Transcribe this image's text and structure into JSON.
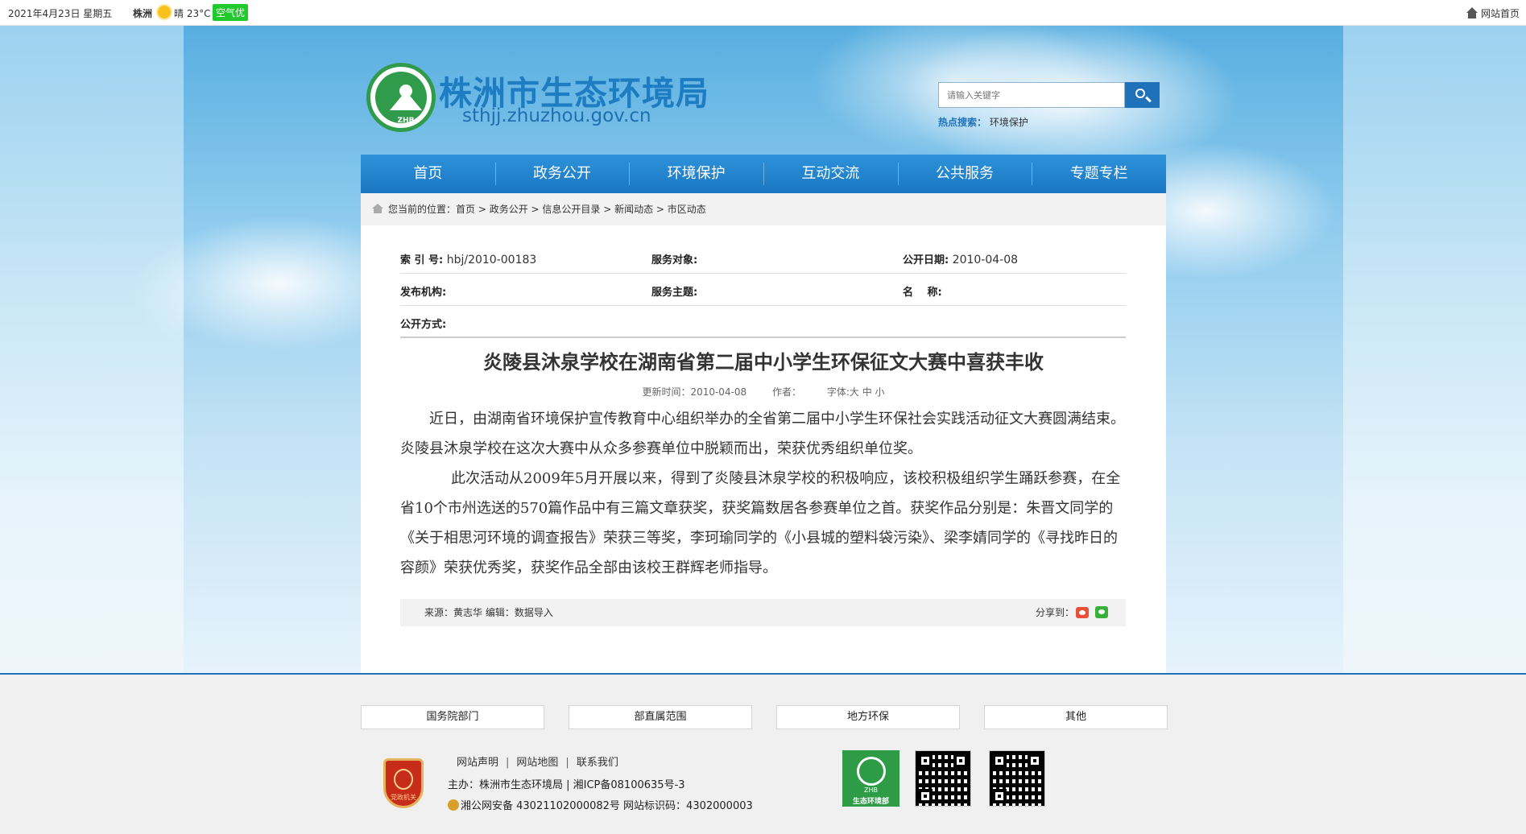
{
  "topbar": {
    "date": "2021年4月23日 星期五",
    "city": "株洲",
    "weather": "晴 23°C",
    "aqi": "空气优",
    "home_link": "网站首页"
  },
  "header": {
    "site_name": "株洲市生态环境局",
    "site_url": "sthjj.zhuzhou.gov.cn",
    "logo_text": "ZHB",
    "search_placeholder": "请输入关键字",
    "hot_label": "热点搜索",
    "hot_sep": "：",
    "hot_keyword": "环境保护"
  },
  "nav": {
    "items": [
      "首页",
      "政务公开",
      "环境保护",
      "互动交流",
      "公共服务",
      "专题专栏"
    ]
  },
  "breadcrumb": {
    "prefix": "您当前的位置：",
    "path": "首页 > 政务公开 > 信息公开目录 > 新闻动态 > 市区动态"
  },
  "meta": {
    "index_label": "索 引 号:",
    "index_value": "hbj/2010-00183",
    "target_label": "服务对象:",
    "target_value": "",
    "date_label": "公开日期:",
    "date_value": "2010-04-08",
    "publisher_label": "发布机构:",
    "publisher_value": "",
    "topic_label": "服务主题:",
    "topic_value": "",
    "name_label": "名　 称:",
    "name_value": "",
    "method_label": "公开方式:",
    "method_value": ""
  },
  "article": {
    "title": "炎陵县沐泉学校在湖南省第二届中小学生环保征文大赛中喜获丰收",
    "updated": "更新时间：2010-04-08",
    "author": "作者：",
    "font_size": "字体:大 中 小",
    "paragraphs": [
      "近日，由湖南省环境保护宣传教育中心组织举办的全省第二届中小学生环保社会实践活动征文大赛圆满结束。炎陵县沐泉学校在这次大赛中从众多参赛单位中脱颖而出，荣获优秀组织单位奖。",
      "此次活动从2009年5月开展以来，得到了炎陵县沐泉学校的积极响应，该校积极组织学生踊跃参赛，在全省10个市州选送的570篇作品中有三篇文章获奖，获奖篇数居各参赛单位之首。获奖作品分别是：朱晋文同学的《关于相思河环境的调查报告》荣获三等奖，李珂瑜同学的《小县城的塑料袋污染》、梁李婧同学的《寻找昨日的容颜》荣获优秀奖，获奖作品全部由该校王群辉老师指导。"
    ],
    "source": "来源：黄志华   编辑：数据导入",
    "share": "分享到："
  },
  "footer": {
    "buttons": [
      "国务院部门",
      "部直属范围",
      "地方环保",
      "其他"
    ],
    "links": [
      "网站声明",
      "网站地图",
      "联系我们"
    ],
    "host": "主办：株洲市生态环境局 | 湘ICP备08100635号-3",
    "police": "湘公网安备 43021102000082号  网站标识码：4302000003",
    "badge_text": "党政机关",
    "zhb_top": "ZHB",
    "zhb_bottom": "生态环境部"
  },
  "colors": {
    "brand_blue": "#1a76c0",
    "brand_green": "#2f9b4b",
    "aqi_green": "#20c92c"
  }
}
